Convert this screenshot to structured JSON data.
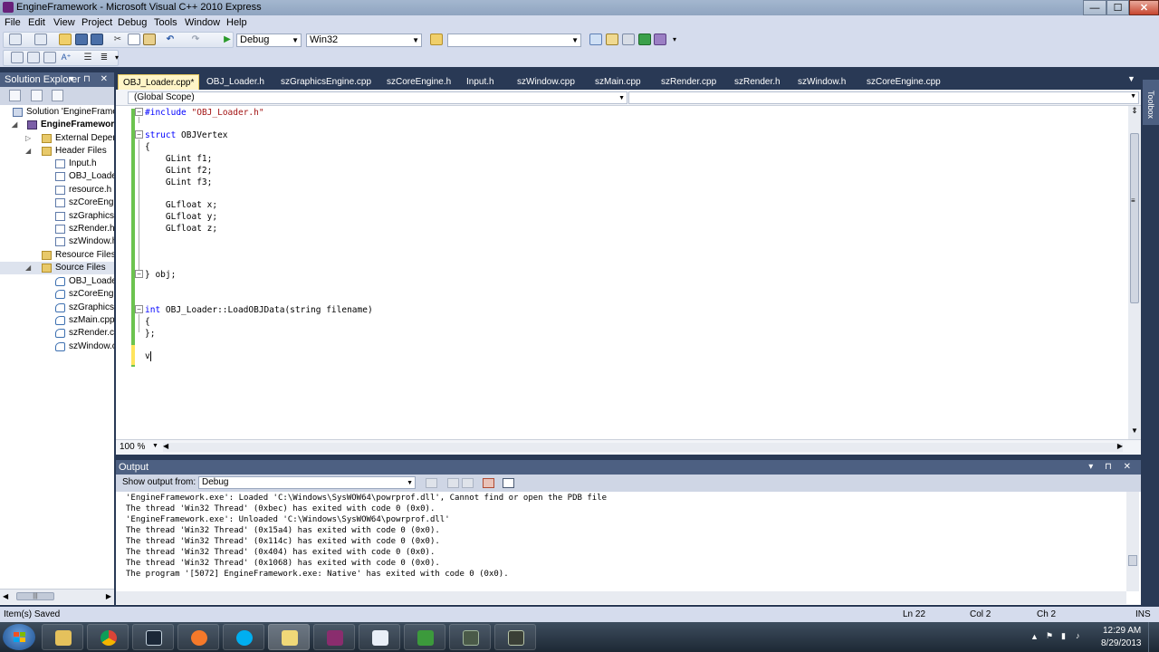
{
  "window": {
    "title": "EngineFramework - Microsoft Visual C++ 2010 Express",
    "min_glyph": "—",
    "max_glyph": "☐",
    "close_glyph": "✕"
  },
  "menu": [
    "File",
    "Edit",
    "View",
    "Project",
    "Debug",
    "Tools",
    "Window",
    "Help"
  ],
  "toolbar": {
    "config": "Debug",
    "platform": "Win32",
    "find": ""
  },
  "solution_explorer": {
    "title": "Solution Explorer",
    "header_buttons": "▾ ⊓ ✕",
    "items": [
      {
        "label": "Solution 'EngineFrame",
        "icon": "solution-icon",
        "expander": ""
      },
      {
        "label": "EngineFramework",
        "icon": "project-icon",
        "expander": "◢"
      },
      {
        "label": "External Depen",
        "icon": "folder-icon",
        "expander": "▷"
      },
      {
        "label": "Header Files",
        "icon": "folder-icon",
        "expander": "◢"
      },
      {
        "label": "Input.h",
        "icon": "header-file-icon",
        "expander": ""
      },
      {
        "label": "OBJ_Loader",
        "icon": "header-file-icon",
        "expander": ""
      },
      {
        "label": "resource.h",
        "icon": "header-file-icon",
        "expander": ""
      },
      {
        "label": "szCoreEngi",
        "icon": "header-file-icon",
        "expander": ""
      },
      {
        "label": "szGraphicsE",
        "icon": "header-file-icon",
        "expander": ""
      },
      {
        "label": "szRender.h",
        "icon": "header-file-icon",
        "expander": ""
      },
      {
        "label": "szWindow.h",
        "icon": "header-file-icon",
        "expander": ""
      },
      {
        "label": "Resource Files",
        "icon": "folder-icon",
        "expander": ""
      },
      {
        "label": "Source Files",
        "icon": "folder-icon",
        "expander": "◢"
      },
      {
        "label": "OBJ_Loader",
        "icon": "cpp-file-icon",
        "expander": ""
      },
      {
        "label": "szCoreEngi",
        "icon": "cpp-file-icon",
        "expander": ""
      },
      {
        "label": "szGraphicsE",
        "icon": "cpp-file-icon",
        "expander": ""
      },
      {
        "label": "szMain.cpp",
        "icon": "cpp-file-icon",
        "expander": ""
      },
      {
        "label": "szRender.cp",
        "icon": "cpp-file-icon",
        "expander": ""
      },
      {
        "label": "szWindow.c",
        "icon": "cpp-file-icon",
        "expander": ""
      }
    ],
    "scroll_grip": "|||"
  },
  "tabs": [
    {
      "label": "OBJ_Loader.cpp*",
      "active": true
    },
    {
      "label": "OBJ_Loader.h",
      "active": false
    },
    {
      "label": "szGraphicsEngine.cpp",
      "active": false
    },
    {
      "label": "szCoreEngine.h",
      "active": false
    },
    {
      "label": "Input.h",
      "active": false
    },
    {
      "label": "szWindow.cpp",
      "active": false
    },
    {
      "label": "szMain.cpp",
      "active": false
    },
    {
      "label": "szRender.cpp",
      "active": false
    },
    {
      "label": "szRender.h",
      "active": false
    },
    {
      "label": "szWindow.h",
      "active": false
    },
    {
      "label": "szCoreEngine.cpp",
      "active": false
    }
  ],
  "editor": {
    "scope": "(Global Scope)",
    "member": "",
    "zoom": "100 %",
    "code": {
      "l1_kw": "#include",
      "l1_str": "\"OBJ_Loader.h\"",
      "l2_kw": "struct",
      "l2_rest": " OBJVertex",
      "l3": "{",
      "l4": "    GLint f1;",
      "l5": "    GLint f2;",
      "l6": "    GLint f3;",
      "l7": "    GLfloat x;",
      "l8": "    GLfloat y;",
      "l9": "    GLfloat z;",
      "l10": "} obj;",
      "l11_kw": "int",
      "l11_rest": " OBJ_Loader::LoadOBJData(string filename)",
      "l12": "{",
      "l13": "};",
      "l14": "v"
    }
  },
  "toolbox_label": "Toolbox",
  "output": {
    "title": "Output",
    "header_buttons": "▾ ⊓ ✕",
    "show_from_label": "Show output from:",
    "source": "Debug",
    "lines": [
      "'EngineFramework.exe': Loaded 'C:\\Windows\\SysWOW64\\powrprof.dll', Cannot find or open the PDB file",
      "The thread 'Win32 Thread' (0xbec) has exited with code 0 (0x0).",
      "'EngineFramework.exe': Unloaded 'C:\\Windows\\SysWOW64\\powrprof.dll'",
      "The thread 'Win32 Thread' (0x15a4) has exited with code 0 (0x0).",
      "The thread 'Win32 Thread' (0x114c) has exited with code 0 (0x0).",
      "The thread 'Win32 Thread' (0x404) has exited with code 0 (0x0).",
      "The thread 'Win32 Thread' (0x1068) has exited with code 0 (0x0).",
      "The program '[5072] EngineFramework.exe: Native' has exited with code 0 (0x0)."
    ]
  },
  "status": {
    "message": "Item(s) Saved",
    "ln": "Ln 22",
    "col": "Col 2",
    "ch": "Ch 2",
    "ins": "INS"
  },
  "taskbar": {
    "apps": [
      "explorer-icon",
      "chrome-icon",
      "steam-icon",
      "blender-icon",
      "skype-icon",
      "visual-studio-icon",
      "winrar-icon",
      "notepad-icon",
      "task-manager-icon",
      "media-icon",
      "terminal-icon"
    ],
    "time": "12:29 AM",
    "date": "8/29/2013"
  },
  "colors": {
    "chrome": "#293955",
    "panel_header": "#4d6082",
    "active_tab": "#fff5c7",
    "change_bar": "#6cc34f",
    "keyword": "#0000ff",
    "string": "#a31515"
  }
}
